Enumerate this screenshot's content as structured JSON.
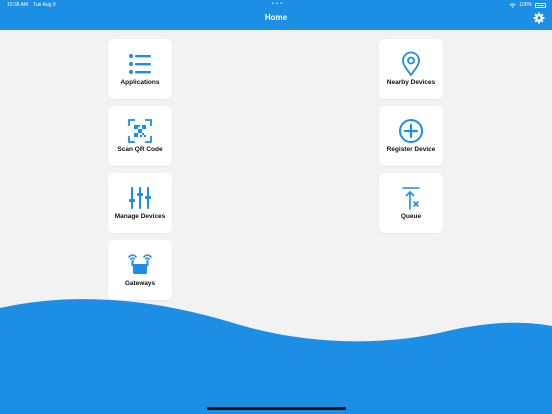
{
  "status_bar": {
    "time": "10:38 AM",
    "date": "Tue Aug 9",
    "dots": "• • •",
    "battery": "100%"
  },
  "header": {
    "title": "Home",
    "settings_icon": "gear-icon"
  },
  "tiles": [
    {
      "label": "Applications",
      "icon": "list-icon"
    },
    {
      "label": "Scan QR Code",
      "icon": "qr-scan-icon"
    },
    {
      "label": "Manage Devices",
      "icon": "sliders-icon"
    },
    {
      "label": "Gateways",
      "icon": "gateway-icon"
    },
    {
      "label": "Nearby Devices",
      "icon": "location-pin-icon"
    },
    {
      "label": "Register Device",
      "icon": "plus-circle-icon"
    },
    {
      "label": "Queue",
      "icon": "queue-icon"
    }
  ],
  "colors": {
    "accent": "#1c8ee3",
    "background": "#f2f2f2",
    "tile": "#ffffff"
  }
}
